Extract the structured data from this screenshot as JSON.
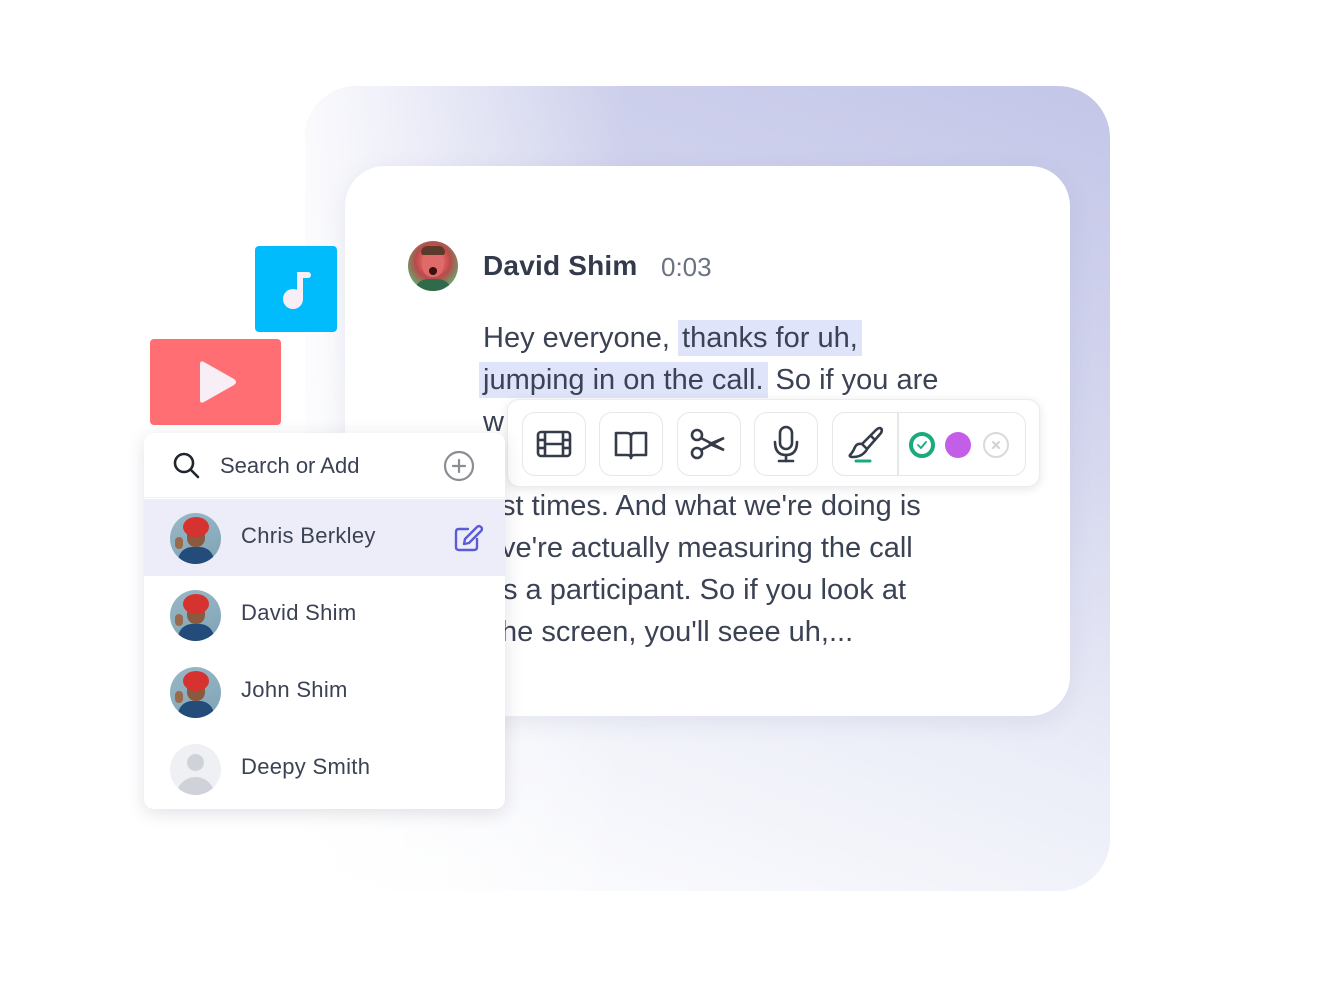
{
  "transcript": {
    "speaker": {
      "name": "David Shim",
      "timestamp": "0:03",
      "avatar_icon": "speaker-photo"
    },
    "lines": [
      {
        "plain": "Hey everyone, ",
        "highlighted": "thanks for uh,"
      },
      {
        "highlighted": "jumping in on the call.",
        "plain": " So if you are"
      },
      {
        "plain": "w"
      },
      {
        "plain": ":"
      },
      {
        "plain": "st times. And what we're doing is"
      },
      {
        "plain": "ve're actually measuring the call"
      },
      {
        "plain": "s a participant. So if you look at"
      },
      {
        "plain": "he screen, you'll seee uh,..."
      }
    ],
    "highlight_color": "#dfe4fb"
  },
  "toolbar": {
    "tools": [
      {
        "name": "clip",
        "icon": "film-icon"
      },
      {
        "name": "chapter",
        "icon": "book-open-icon"
      },
      {
        "name": "cut",
        "icon": "scissors-icon"
      },
      {
        "name": "voice",
        "icon": "microphone-icon"
      },
      {
        "name": "highlight",
        "icon": "paintbrush-icon"
      }
    ],
    "swatches": [
      {
        "name": "green",
        "color": "#1aaa7e",
        "selected": true
      },
      {
        "name": "purple",
        "color": "#c35ee8",
        "selected": false
      },
      {
        "name": "clear",
        "color": "#d8d9dc",
        "selected": false
      }
    ]
  },
  "media_tiles": {
    "video": {
      "icon": "play-icon",
      "color": "#ff6e73"
    },
    "audio": {
      "icon": "music-note-icon",
      "color": "#00bcfd"
    }
  },
  "speaker_picker": {
    "search": {
      "placeholder": "Search or Add",
      "value": ""
    },
    "people": [
      {
        "name": "Chris Berkley",
        "selected": true,
        "has_photo": true
      },
      {
        "name": "David Shim",
        "selected": false,
        "has_photo": true
      },
      {
        "name": "John Shim",
        "selected": false,
        "has_photo": true
      },
      {
        "name": "Deepy Smith",
        "selected": false,
        "has_photo": false
      }
    ],
    "accent_color": "#5b5bd6"
  }
}
